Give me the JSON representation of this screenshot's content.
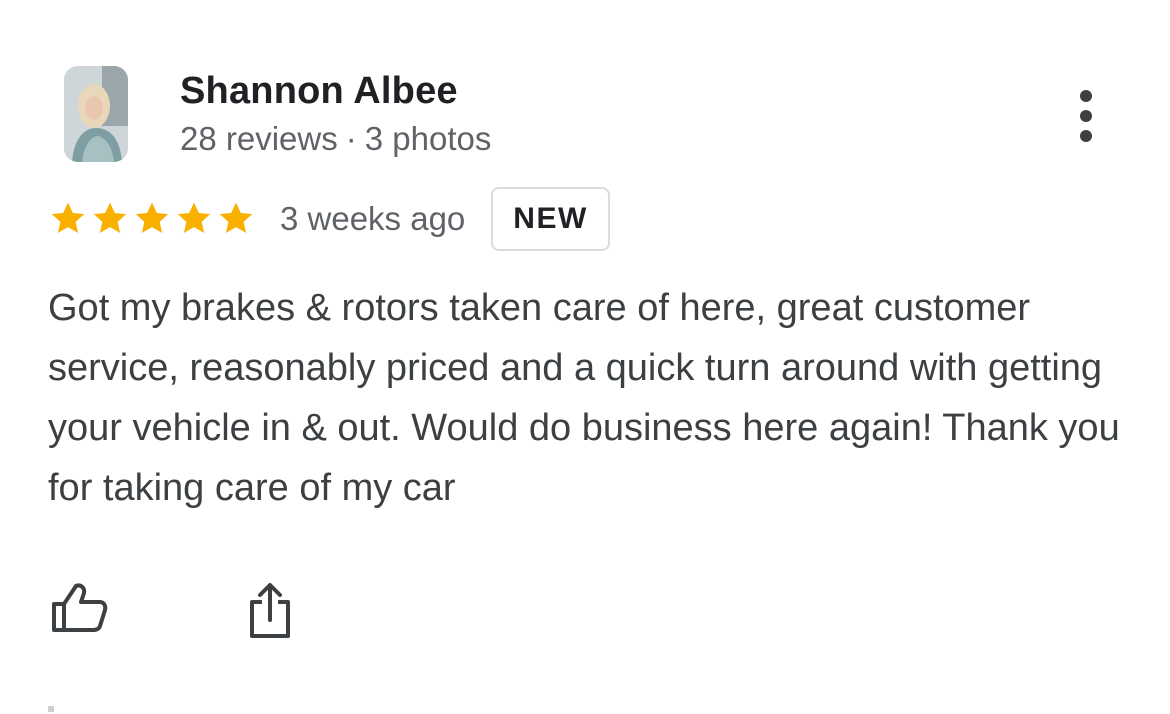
{
  "reviewer": {
    "name": "Shannon Albee",
    "review_count": "28 reviews",
    "separator": "·",
    "photo_count": "3 photos",
    "avatar_icon": "profile-photo"
  },
  "rating": {
    "stars": 5,
    "star_color": "#f9b000",
    "time_ago": "3 weeks ago",
    "badge": "NEW"
  },
  "review_text": "Got my brakes & rotors taken care of here, great customer service, reasonably priced and a quick turn around with getting your vehicle in & out. Would do business here again! Thank you for taking care of my car",
  "actions": {
    "like_icon": "thumbs-up-icon",
    "share_icon": "share-icon",
    "more_icon": "more-vertical-icon"
  }
}
